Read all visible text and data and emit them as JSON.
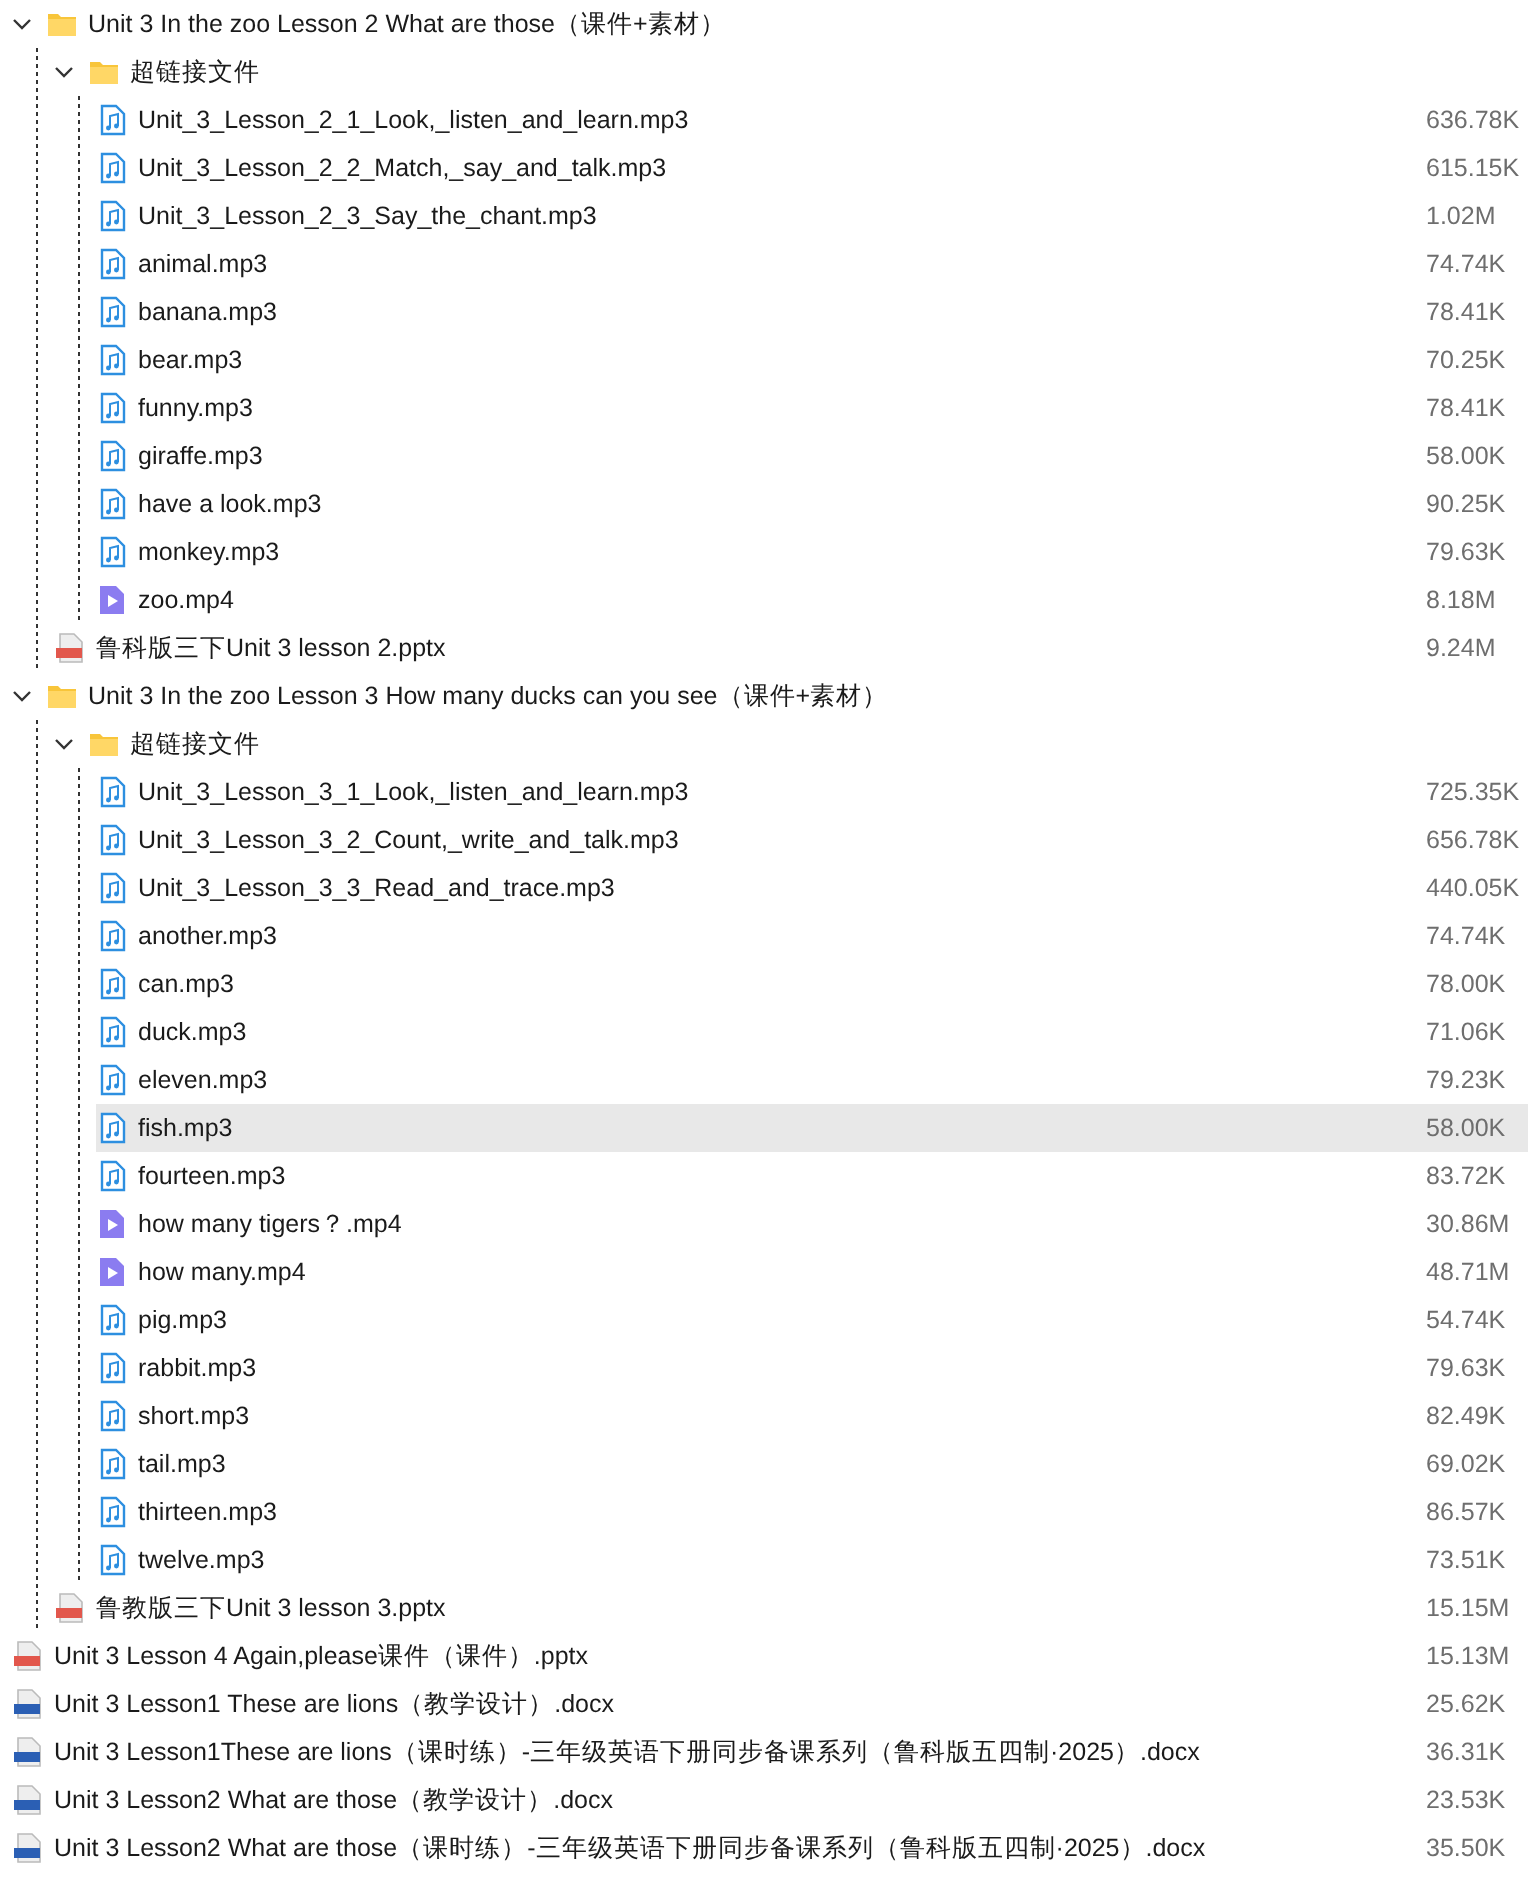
{
  "tree": [
    {
      "kind": "folder",
      "name": "Unit 3 In the zoo Lesson 2 What are those（课件+素材）",
      "expanded": true,
      "selected": false,
      "children": [
        {
          "kind": "folder",
          "name": "超链接文件",
          "expanded": true,
          "selected": false,
          "children": [
            {
              "kind": "audio",
              "name": "Unit_3_Lesson_2_1_Look,_listen_and_learn.mp3",
              "size": "636.78K",
              "selected": false
            },
            {
              "kind": "audio",
              "name": "Unit_3_Lesson_2_2_Match,_say_and_talk.mp3",
              "size": "615.15K",
              "selected": false
            },
            {
              "kind": "audio",
              "name": "Unit_3_Lesson_2_3_Say_the_chant.mp3",
              "size": "1.02M",
              "selected": false
            },
            {
              "kind": "audio",
              "name": "animal.mp3",
              "size": "74.74K",
              "selected": false
            },
            {
              "kind": "audio",
              "name": "banana.mp3",
              "size": "78.41K",
              "selected": false
            },
            {
              "kind": "audio",
              "name": "bear.mp3",
              "size": "70.25K",
              "selected": false
            },
            {
              "kind": "audio",
              "name": "funny.mp3",
              "size": "78.41K",
              "selected": false
            },
            {
              "kind": "audio",
              "name": "giraffe.mp3",
              "size": "58.00K",
              "selected": false
            },
            {
              "kind": "audio",
              "name": "have a look.mp3",
              "size": "90.25K",
              "selected": false
            },
            {
              "kind": "audio",
              "name": "monkey.mp3",
              "size": "79.63K",
              "selected": false
            },
            {
              "kind": "video",
              "name": "zoo.mp4",
              "size": "8.18M",
              "selected": false
            }
          ]
        },
        {
          "kind": "pptx",
          "name": "鲁科版三下Unit 3 lesson 2.pptx",
          "size": "9.24M",
          "selected": false
        }
      ]
    },
    {
      "kind": "folder",
      "name": "Unit 3 In the zoo Lesson 3 How many ducks can you see（课件+素材）",
      "expanded": true,
      "selected": false,
      "children": [
        {
          "kind": "folder",
          "name": "超链接文件",
          "expanded": true,
          "selected": false,
          "children": [
            {
              "kind": "audio",
              "name": "Unit_3_Lesson_3_1_Look,_listen_and_learn.mp3",
              "size": "725.35K",
              "selected": false
            },
            {
              "kind": "audio",
              "name": "Unit_3_Lesson_3_2_Count,_write_and_talk.mp3",
              "size": "656.78K",
              "selected": false
            },
            {
              "kind": "audio",
              "name": "Unit_3_Lesson_3_3_Read_and_trace.mp3",
              "size": "440.05K",
              "selected": false
            },
            {
              "kind": "audio",
              "name": "another.mp3",
              "size": "74.74K",
              "selected": false
            },
            {
              "kind": "audio",
              "name": "can.mp3",
              "size": "78.00K",
              "selected": false
            },
            {
              "kind": "audio",
              "name": "duck.mp3",
              "size": "71.06K",
              "selected": false
            },
            {
              "kind": "audio",
              "name": "eleven.mp3",
              "size": "79.23K",
              "selected": false
            },
            {
              "kind": "audio",
              "name": "fish.mp3",
              "size": "58.00K",
              "selected": true
            },
            {
              "kind": "audio",
              "name": "fourteen.mp3",
              "size": "83.72K",
              "selected": false
            },
            {
              "kind": "video",
              "name": "how many tigers？.mp4",
              "size": "30.86M",
              "selected": false
            },
            {
              "kind": "video",
              "name": "how many.mp4",
              "size": "48.71M",
              "selected": false
            },
            {
              "kind": "audio",
              "name": "pig.mp3",
              "size": "54.74K",
              "selected": false
            },
            {
              "kind": "audio",
              "name": "rabbit.mp3",
              "size": "79.63K",
              "selected": false
            },
            {
              "kind": "audio",
              "name": "short.mp3",
              "size": "82.49K",
              "selected": false
            },
            {
              "kind": "audio",
              "name": "tail.mp3",
              "size": "69.02K",
              "selected": false
            },
            {
              "kind": "audio",
              "name": "thirteen.mp3",
              "size": "86.57K",
              "selected": false
            },
            {
              "kind": "audio",
              "name": "twelve.mp3",
              "size": "73.51K",
              "selected": false
            }
          ]
        },
        {
          "kind": "pptx",
          "name": "鲁教版三下Unit 3 lesson 3.pptx",
          "size": "15.15M",
          "selected": false
        }
      ]
    },
    {
      "kind": "pptx",
      "name": "Unit 3 Lesson 4 Again,please课件（课件）.pptx",
      "size": "15.13M",
      "selected": false
    },
    {
      "kind": "docx",
      "name": "Unit 3 Lesson1 These are lions（教学设计）.docx",
      "size": "25.62K",
      "selected": false
    },
    {
      "kind": "docx",
      "name": "Unit 3 Lesson1These are lions（课时练）-三年级英语下册同步备课系列（鲁科版五四制·2025）.docx",
      "size": "36.31K",
      "selected": false
    },
    {
      "kind": "docx",
      "name": "Unit 3 Lesson2 What are those（教学设计）.docx",
      "size": "23.53K",
      "selected": false
    },
    {
      "kind": "docx",
      "name": "Unit 3 Lesson2 What are those（课时练）-三年级英语下册同步备课系列（鲁科版五四制·2025）.docx",
      "size": "35.50K",
      "selected": false
    }
  ]
}
